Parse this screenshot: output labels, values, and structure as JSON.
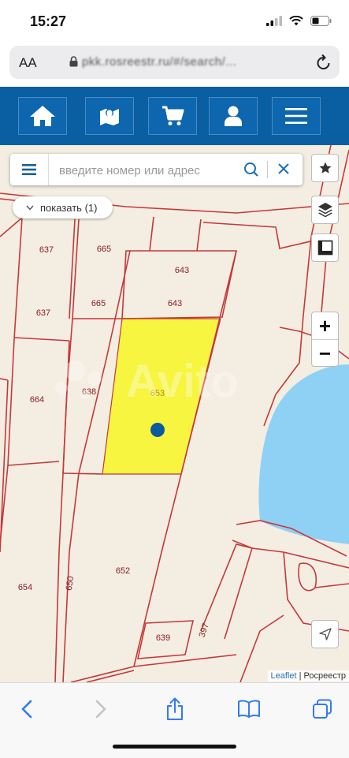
{
  "status": {
    "time": "15:27"
  },
  "browser": {
    "aa_label": "AA",
    "url": "pkk.rosreestr.ru/#/search/..."
  },
  "navbar": {
    "items": [
      "home",
      "map",
      "cart",
      "user",
      "menu"
    ]
  },
  "search": {
    "placeholder": "введите номер или адрес"
  },
  "show_button": {
    "label": "показать (1)"
  },
  "map": {
    "parcel_labels": [
      "637",
      "665",
      "643",
      "637",
      "665",
      "643",
      "664",
      "638",
      "653",
      "650",
      "652",
      "654",
      "639",
      "397"
    ],
    "highlight_color": "#f7f53f",
    "water_color": "#8fd0f5",
    "boundary_color": "#c8373b"
  },
  "attribution": {
    "leaflet": "Leaflet",
    "separator": " | ",
    "source": "Росреестр"
  },
  "watermark": "Avito",
  "colors": {
    "navbar": "#0a5ea2",
    "ios_blue": "#2f7bf6"
  }
}
